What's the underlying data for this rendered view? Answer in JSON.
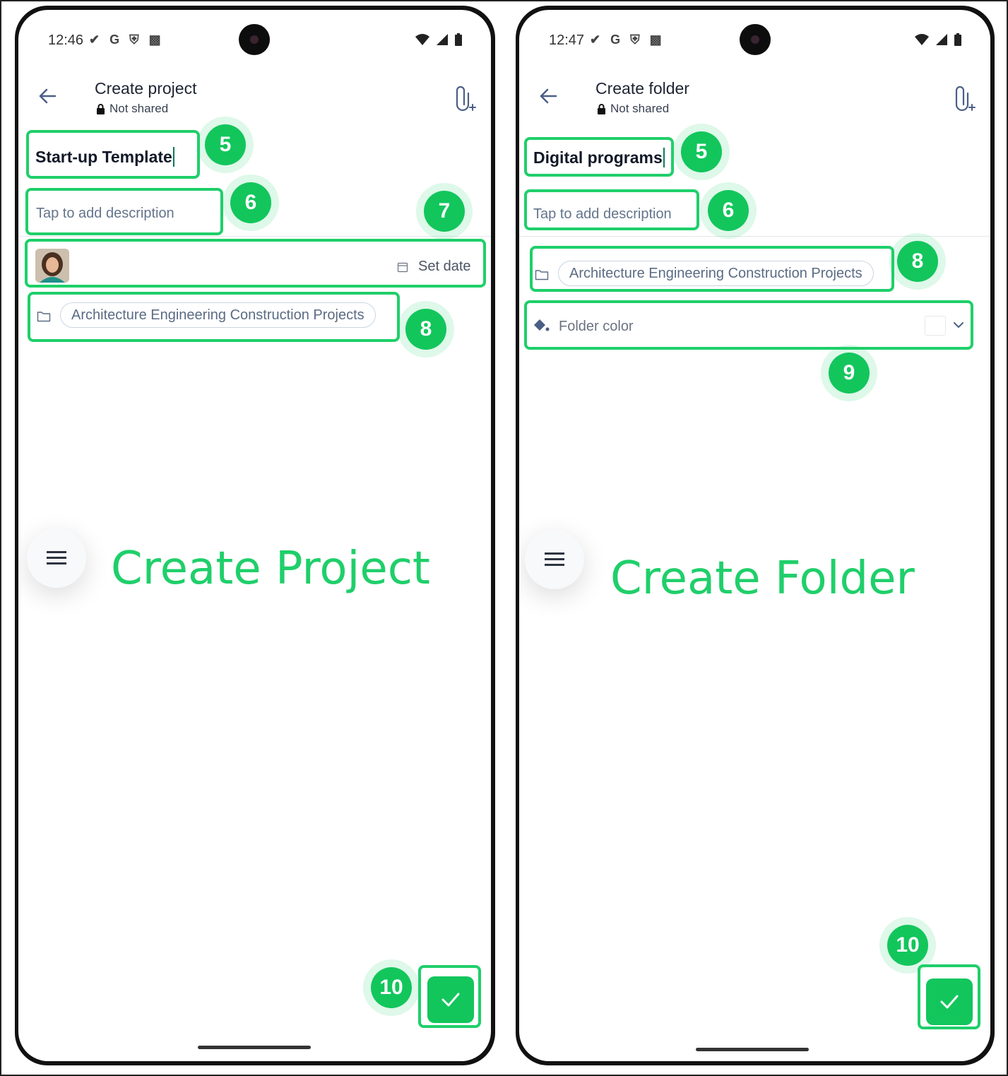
{
  "left": {
    "status": {
      "time": "12:46",
      "icons": [
        "check-icon",
        "google-icon",
        "shield-icon",
        "a-icon"
      ]
    },
    "title": "Create project",
    "subtitle": "Not shared",
    "name_value": "Start-up Template",
    "description_placeholder": "Tap to add description",
    "set_date_label": "Set date",
    "folder_chip": "Architecture Engineering Construction Projects",
    "caption": "Create Project",
    "badges": [
      "5",
      "6",
      "7",
      "8",
      "10"
    ]
  },
  "right": {
    "status": {
      "time": "12:47",
      "icons": [
        "check-icon",
        "google-icon",
        "shield-icon",
        "a-icon"
      ]
    },
    "title": "Create folder",
    "subtitle": "Not shared",
    "name_value": "Digital programs",
    "description_placeholder": "Tap to add description",
    "folder_chip": "Architecture Engineering Construction Projects",
    "folder_color_label": "Folder color",
    "caption": "Create Folder",
    "badges": [
      "5",
      "6",
      "8",
      "9",
      "10"
    ]
  },
  "colors": {
    "highlight": "#1fcf6a",
    "accent_green": "#12c65c",
    "text_primary": "#1e2432",
    "text_muted": "#64748b"
  }
}
